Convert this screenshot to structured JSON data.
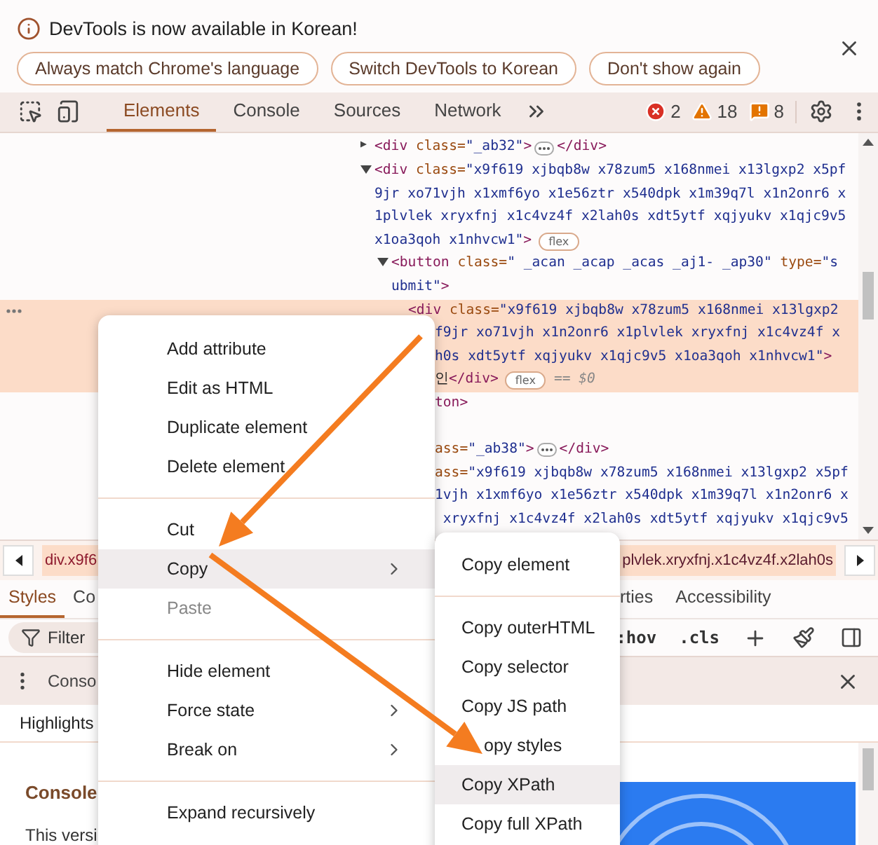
{
  "infobar": {
    "message": "DevTools is now available in Korean!",
    "buttons": [
      "Always match Chrome's language",
      "Switch DevTools to Korean",
      "Don't show again"
    ]
  },
  "toolbar": {
    "tabs": [
      {
        "label": "Elements",
        "selected": true
      },
      {
        "label": "Console",
        "selected": false
      },
      {
        "label": "Sources",
        "selected": false
      },
      {
        "label": "Network",
        "selected": false
      }
    ],
    "counters": [
      {
        "kind": "error",
        "count": "2"
      },
      {
        "kind": "warning",
        "count": "18"
      },
      {
        "kind": "issue",
        "count": "8"
      }
    ]
  },
  "tree": [
    {
      "expanded": false,
      "selected": false,
      "lines": [
        {
          "kind": "full",
          "segs": [
            {
              "kind": "tag",
              "text": "<div"
            },
            {
              "kind": "attr",
              "text": " class="
            },
            {
              "kind": "val",
              "text": "\"_ab32\""
            },
            {
              "kind": "tag",
              "text": ">"
            },
            {
              "kind": "ellipsis"
            },
            {
              "kind": "tag",
              "text": "</div>"
            }
          ]
        }
      ]
    },
    {
      "expanded": true,
      "selected": false,
      "lines": [
        {
          "kind": "full",
          "segs": [
            {
              "kind": "tag",
              "text": "<div"
            },
            {
              "kind": "attr",
              "text": " class="
            },
            {
              "kind": "val",
              "text": "\"x9f619 xjbqb8w x78zum5 x168nmei x13lgxp2 x5pf"
            }
          ]
        },
        {
          "kind": "full",
          "segs": [
            {
              "kind": "val",
              "text": "9jr xo71vjh x1xmf6yo x1e56ztr x540dpk x1m39q7l x1n2onr6 x"
            }
          ]
        },
        {
          "kind": "full",
          "segs": [
            {
              "kind": "val",
              "text": "1plvlek xryxfnj x1c4vz4f x2lah0s xdt5ytf xqjyukv x1qjc9v5"
            }
          ]
        },
        {
          "kind": "full",
          "segs": [
            {
              "kind": "val",
              "text": "x1oa3qoh x1nhvcw1\""
            },
            {
              "kind": "tag",
              "text": ">"
            },
            {
              "kind": "flex",
              "text": "flex"
            }
          ]
        }
      ],
      "children": [
        {
          "expanded": true,
          "selected": false,
          "lines": [
            {
              "kind": "full",
              "segs": [
                {
                  "kind": "tag",
                  "text": "<button"
                },
                {
                  "kind": "attr",
                  "text": " class="
                },
                {
                  "kind": "val",
                  "text": "\" _acan _acap _acas _aj1- _ap30\""
                },
                {
                  "kind": "attr",
                  "text": " type="
                },
                {
                  "kind": "val",
                  "text": "\"s"
                }
              ]
            },
            {
              "kind": "full",
              "segs": [
                {
                  "kind": "val",
                  "text": "ubmit\""
                },
                {
                  "kind": "tag",
                  "text": ">"
                }
              ]
            }
          ],
          "children": [
            {
              "selected": true,
              "lines": [
                {
                  "kind": "full",
                  "segs": [
                    {
                      "kind": "tag",
                      "text": "<div"
                    },
                    {
                      "kind": "attr",
                      "text": " class="
                    },
                    {
                      "kind": "val",
                      "text": "\"x9f619 xjbqb8w x78zum5 x168nmei x13lgxp2"
                    }
                  ]
                },
                {
                  "kind": "cut",
                  "segs": [
                    {
                      "kind": "val",
                      "text": "f9jr xo71vjh x1n2onr6 x1plvlek xryxfnj x1c4vz4f x"
                    }
                  ]
                },
                {
                  "kind": "cut",
                  "segs": [
                    {
                      "kind": "val",
                      "text": "h0s xdt5ytf xqjyukv x1qjc9v5 x1oa3qoh x1nhvcw1\""
                    },
                    {
                      "kind": "tag",
                      "text": ">"
                    }
                  ]
                },
                {
                  "kind": "cut",
                  "segs": [
                    {
                      "kind": "text",
                      "text": "인"
                    },
                    {
                      "kind": "tag",
                      "text": "</div>"
                    },
                    {
                      "kind": "flex",
                      "text": "flex"
                    },
                    {
                      "kind": "eq",
                      "text": "== $0"
                    }
                  ]
                }
              ]
            }
          ]
        },
        {
          "selected": false,
          "lines": [
            {
              "kind": "cut",
              "segs": [
                {
                  "kind": "tag",
                  "text": "ton>"
                }
              ]
            },
            {
              "kind": "hidden"
            }
          ]
        },
        {
          "selected": false,
          "lines": [
            {
              "kind": "cut",
              "segs": [
                {
                  "kind": "attr",
                  "text": "ass="
                },
                {
                  "kind": "val",
                  "text": "\"_ab38\""
                },
                {
                  "kind": "tag",
                  "text": ">"
                },
                {
                  "kind": "ellipsis"
                },
                {
                  "kind": "tag",
                  "text": "</div>"
                }
              ]
            }
          ]
        },
        {
          "selected": false,
          "lines": [
            {
              "kind": "cut",
              "segs": [
                {
                  "kind": "attr",
                  "text": "ass="
                },
                {
                  "kind": "val",
                  "text": "\"x9f619 xjbqb8w x78zum5 x168nmei x13lgxp2 x5pf"
                }
              ]
            },
            {
              "kind": "cut",
              "segs": [
                {
                  "kind": "val",
                  "text": "1vjh x1xmf6yo x1e56ztr x540dpk x1m39q7l x1n2onr6 x"
                }
              ]
            },
            {
              "kind": "cut",
              "segs": [
                {
                  "kind": "val",
                  "text": " xryxfnj x1c4vz4f x2lah0s xdt5ytf xqjyukv x1qjc9v5"
                }
              ]
            }
          ]
        }
      ]
    }
  ],
  "breadcrumbs": [
    "div.x9f6",
    "plvlek.xryxfnj.x1c4vz4f.x2lah0s"
  ],
  "styles_tabs": {
    "left": [
      {
        "label": "Styles",
        "selected": true
      },
      {
        "label": "Co",
        "selected": false
      }
    ],
    "right": [
      {
        "label": "rties",
        "selected": false
      },
      {
        "label": "Accessibility",
        "selected": false
      }
    ]
  },
  "filter": {
    "placeholder": "Filter"
  },
  "style_tools": [
    ":hov",
    ".cls"
  ],
  "drawer": {
    "tab": "Conso",
    "highlights": "Highlights",
    "heading": "Console",
    "text": "This versi"
  },
  "context_menu": [
    {
      "kind": "item",
      "label": "Add attribute",
      "highlighted": false,
      "disabled": false,
      "has_submenu": false
    },
    {
      "kind": "item",
      "label": "Edit as HTML",
      "highlighted": false,
      "disabled": false,
      "has_submenu": false
    },
    {
      "kind": "item",
      "label": "Duplicate element",
      "highlighted": false,
      "disabled": false,
      "has_submenu": false
    },
    {
      "kind": "item",
      "label": "Delete element",
      "highlighted": false,
      "disabled": false,
      "has_submenu": false
    },
    {
      "kind": "separator"
    },
    {
      "kind": "item",
      "label": "Cut",
      "highlighted": false,
      "disabled": false,
      "has_submenu": false
    },
    {
      "kind": "item",
      "label": "Copy",
      "highlighted": true,
      "disabled": false,
      "has_submenu": true
    },
    {
      "kind": "item",
      "label": "Paste",
      "highlighted": false,
      "disabled": true,
      "has_submenu": false
    },
    {
      "kind": "separator"
    },
    {
      "kind": "item",
      "label": "Hide element",
      "highlighted": false,
      "disabled": false,
      "has_submenu": false
    },
    {
      "kind": "item",
      "label": "Force state",
      "highlighted": false,
      "disabled": false,
      "has_submenu": true
    },
    {
      "kind": "item",
      "label": "Break on",
      "highlighted": false,
      "disabled": false,
      "has_submenu": true
    },
    {
      "kind": "separator"
    },
    {
      "kind": "item",
      "label": "Expand recursively",
      "highlighted": false,
      "disabled": false,
      "has_submenu": false
    }
  ],
  "submenu": [
    {
      "kind": "item",
      "label": "Copy element",
      "highlighted": false
    },
    {
      "kind": "separator"
    },
    {
      "kind": "item",
      "label": "Copy outerHTML",
      "highlighted": false
    },
    {
      "kind": "item",
      "label": "Copy selector",
      "highlighted": false
    },
    {
      "kind": "item",
      "label": "Copy JS path",
      "highlighted": false
    },
    {
      "kind": "covered_item",
      "label": "opy styles",
      "highlighted": false
    },
    {
      "kind": "item",
      "label": "Copy XPath",
      "highlighted": true
    },
    {
      "kind": "item",
      "label": "Copy full XPath",
      "highlighted": false
    }
  ]
}
